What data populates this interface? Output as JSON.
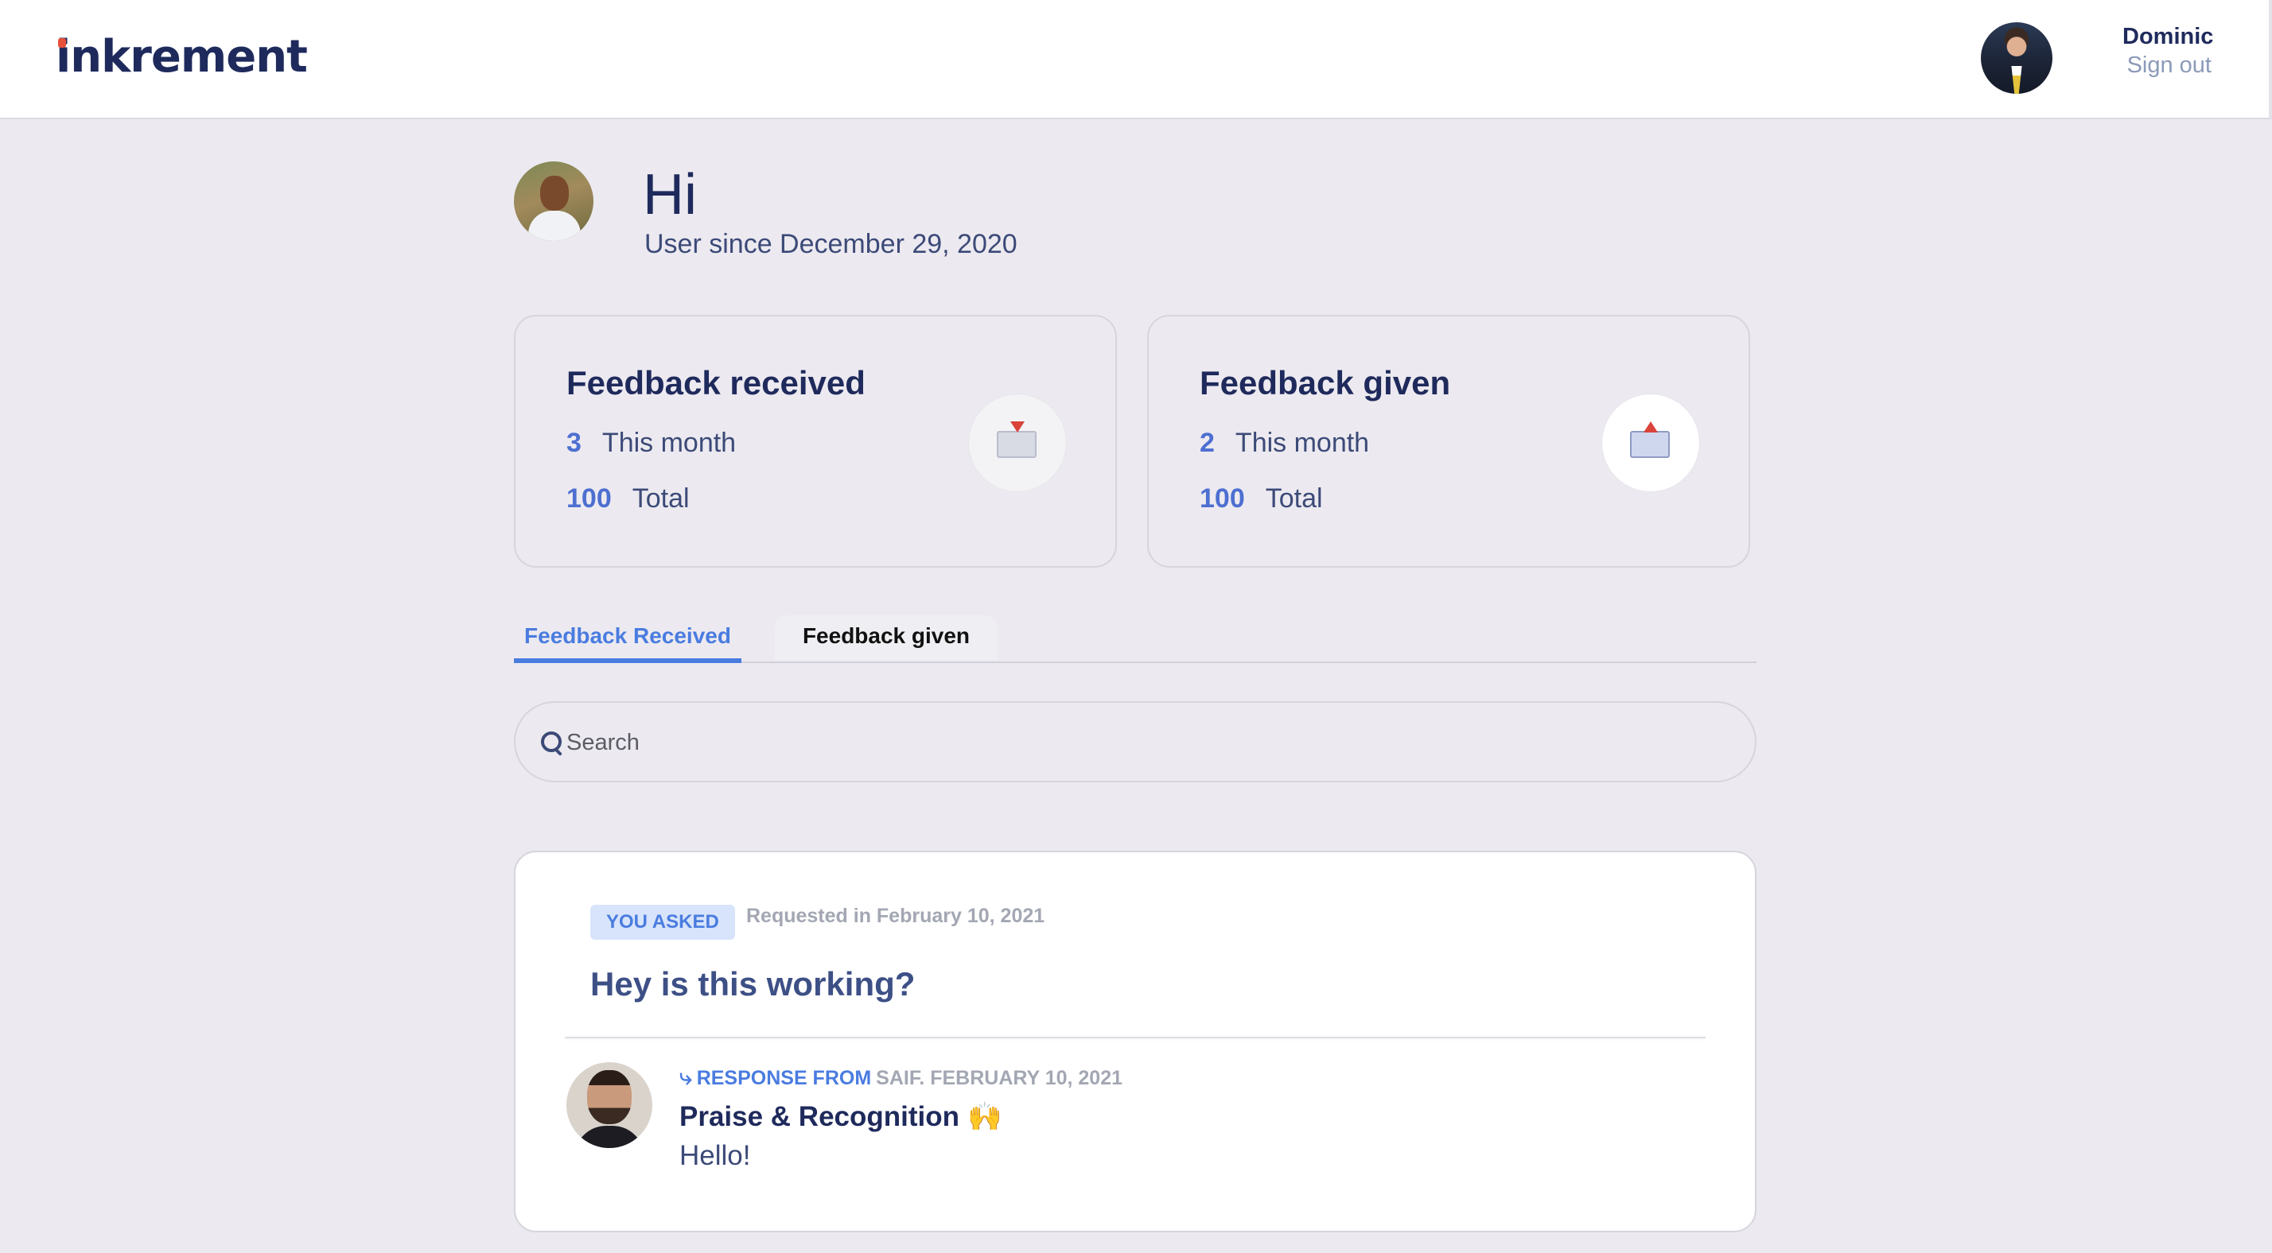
{
  "header": {
    "logo": "inkrement",
    "user_name": "Dominic",
    "sign_out_label": "Sign out"
  },
  "profile": {
    "greeting": "Hi",
    "user_since": "User since December 29, 2020"
  },
  "stats": {
    "received": {
      "title": "Feedback received",
      "month_count": "3",
      "month_label": "This month",
      "total_count": "100",
      "total_label": "Total",
      "icon": "incoming-envelope-icon"
    },
    "given": {
      "title": "Feedback given",
      "month_count": "2",
      "month_label": "This month",
      "total_count": "100",
      "total_label": "Total",
      "icon": "outbox-tray-icon"
    }
  },
  "tabs": [
    {
      "label": "Feedback Received",
      "active": true
    },
    {
      "label": "Feedback given",
      "active": false
    }
  ],
  "search": {
    "placeholder": "Search",
    "value": ""
  },
  "feedback_items": [
    {
      "badge": "YOU ASKED",
      "requested": "Requested in February 10, 2021",
      "question": "Hey is this working?",
      "response": {
        "arrow": "⤷",
        "from_label": "RESPONSE FROM",
        "by": "SAIF. FEBRUARY 10, 2021",
        "category": "Praise & Recognition",
        "category_emoji": "🙌",
        "text": "Hello!"
      }
    }
  ],
  "colors": {
    "accent": "#4a7ce0",
    "navy": "#1f2a5c",
    "background": "#eceaf0",
    "logo_mark": "#e8503a"
  }
}
